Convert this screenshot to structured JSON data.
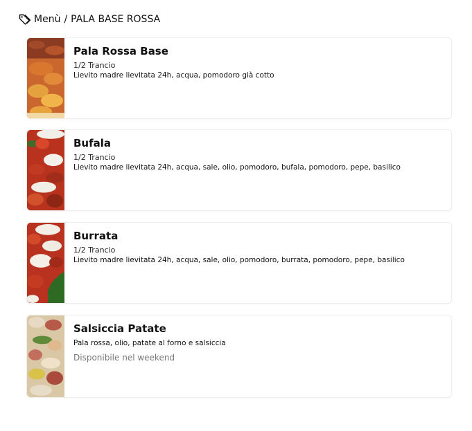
{
  "breadcrumb": {
    "icon": "tag-icon",
    "root": "Menù",
    "separator": "/",
    "current": "PALA BASE ROSSA"
  },
  "items": [
    {
      "title": "Pala Rossa Base",
      "portion": "1/2 Trancio",
      "description": "Lievito madre lievitata 24h, acqua, pomodoro già cotto",
      "note": ""
    },
    {
      "title": "Bufala",
      "portion": "1/2 Trancio",
      "description": "Lievito madre lievitata 24h, acqua, sale, olio, pomodoro, bufala, pomodoro, pepe, basilico",
      "note": ""
    },
    {
      "title": "Burrata",
      "portion": "1/2 Trancio",
      "description": "Lievito madre lievitata 24h, acqua, sale, olio, pomodoro, burrata, pomodoro, pepe, basilico",
      "note": ""
    },
    {
      "title": "Salsiccia Patate",
      "portion": "",
      "description": "Pala rossa, olio, patate al forno e salsiccia",
      "note": "Disponibile nel weekend"
    }
  ]
}
